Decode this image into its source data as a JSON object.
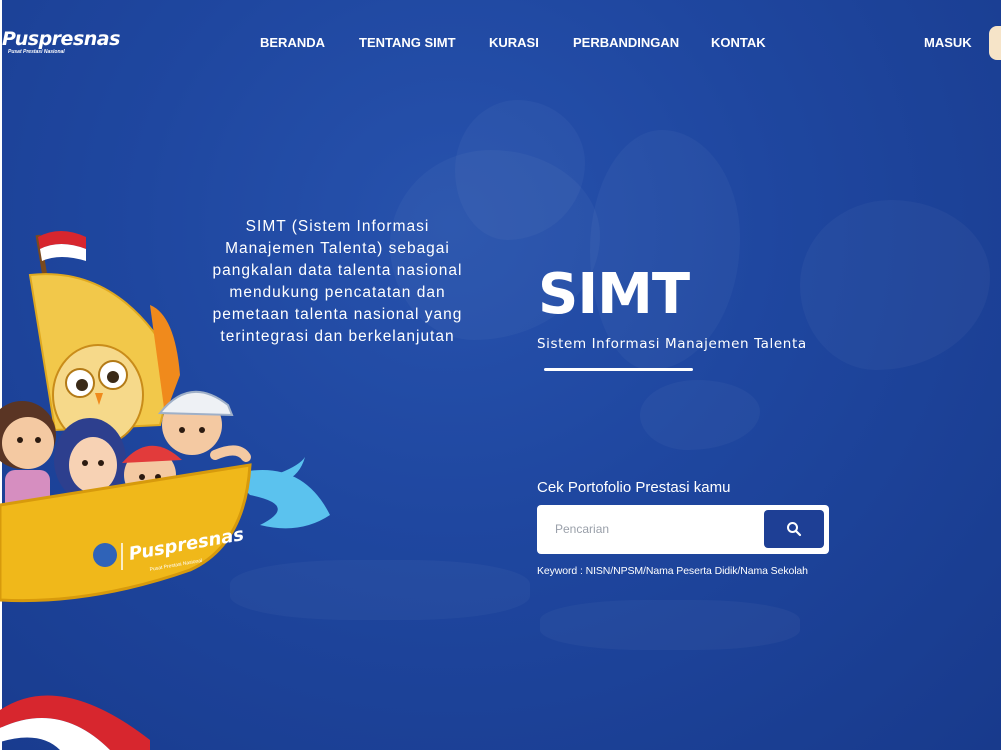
{
  "header": {
    "logo_text": "Puspresnas",
    "logo_subtitle": "Pusat Prestasi Nasional",
    "nav": [
      {
        "label": "BERANDA"
      },
      {
        "label": "TENTANG SIMT"
      },
      {
        "label": "KURASI"
      },
      {
        "label": "PERBANDINGAN"
      },
      {
        "label": "KONTAK"
      }
    ],
    "login_label": "MASUK"
  },
  "intro": {
    "description": "SIMT (Sistem Informasi Manajemen Talenta) sebagai pangkalan data talenta nasional mendukung pencatatan dan pemetaan talenta nasional yang terintegrasi dan berkelanjutan"
  },
  "illustration": {
    "boat_logo_text": "Puspresnas",
    "boat_logo_subtitle": "Pusat Prestasi Nasional"
  },
  "hero": {
    "title": "SIMT",
    "subtitle": "Sistem Informasi Manajemen Talenta"
  },
  "search": {
    "label": "Cek Portofolio Prestasi kamu",
    "placeholder": "Pencarian",
    "value": "",
    "button_icon": "search-icon",
    "hint": "Keyword : NISN/NPSM/Nama Peserta Didik/Nama Sekolah"
  },
  "colors": {
    "background": "#1f47a0",
    "search_button": "#1e3f95",
    "boat": "#f0b81a",
    "flag_red": "#d7262e"
  }
}
